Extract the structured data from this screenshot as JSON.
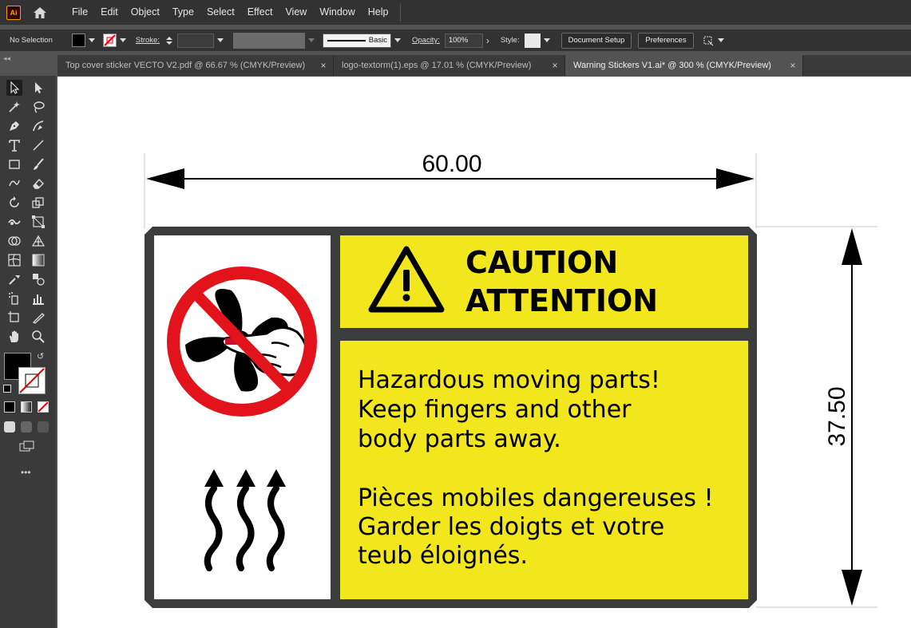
{
  "app": {
    "logo_text": "Ai"
  },
  "menu": [
    "File",
    "Edit",
    "Object",
    "Type",
    "Select",
    "Effect",
    "View",
    "Window",
    "Help"
  ],
  "control_bar": {
    "selection": "No Selection",
    "stroke_label": "Stroke:",
    "brush_label": "Basic",
    "opacity_label": "Opacity:",
    "opacity_value": "100%",
    "style_label": "Style:",
    "doc_setup": "Document Setup",
    "preferences": "Preferences"
  },
  "tabs": [
    {
      "label": "Top cover sticker VECTO V2.pdf @ 66.67 % (CMYK/Preview)",
      "active": false
    },
    {
      "label": "logo-textorm(1).eps @ 17.01 % (CMYK/Preview)",
      "active": false
    },
    {
      "label": "Warning Stickers V1.ai* @ 300 % (CMYK/Preview)",
      "active": true
    }
  ],
  "tab_close": "×",
  "artwork": {
    "width_dim": "60.00",
    "height_dim": "37.50",
    "caption_line1": "CAUTION",
    "caption_line2": "ATTENTION",
    "en_line1": "Hazardous moving parts!",
    "en_line2": "Keep fingers and other",
    "en_line3": "body parts away.",
    "fr_line1": "Pièces mobiles dangereuses !",
    "fr_line2": "Garder les doigts et votre",
    "fr_line3": "teub éloignés."
  },
  "colors": {
    "sticker_yellow": "#f2e61c",
    "sticker_border": "#3a3c3d",
    "prohibition_red": "#e2131b",
    "app_dark": "#323232"
  },
  "more_tools": "•••"
}
